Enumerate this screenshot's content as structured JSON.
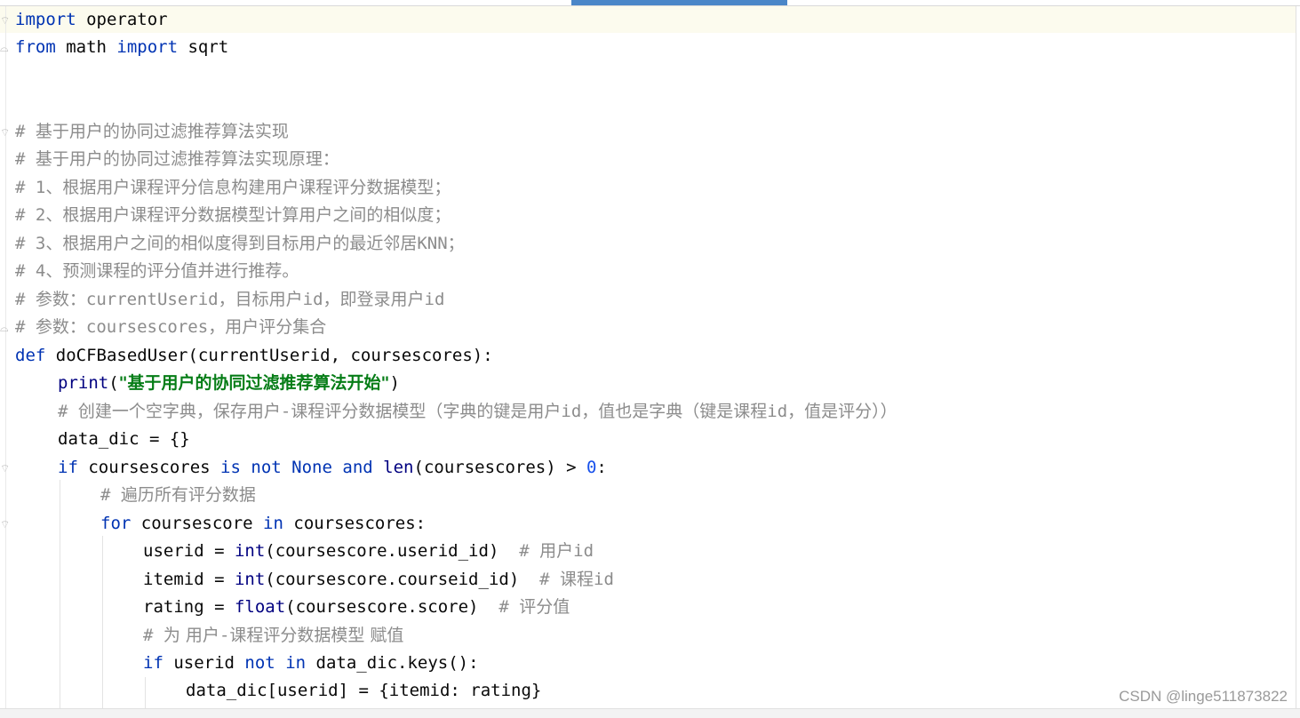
{
  "editor": {
    "colors": {
      "keyword": "#0033b3",
      "comment": "#8c8c8c",
      "string": "#067d17",
      "number": "#1750eb",
      "current_line": "#fcfbee"
    },
    "code": {
      "l1": {
        "kw_import": "import",
        "rest": " operator"
      },
      "l2": {
        "kw_from": "from",
        "mid": " math ",
        "kw_import": "import",
        "rest": " sqrt"
      },
      "l3": {
        "hash": "# ",
        "text": "基于用户的协同过滤推荐算法实现"
      },
      "l4": {
        "hash": "# ",
        "text": "基于用户的协同过滤推荐算法实现原理："
      },
      "l5": {
        "hash": "# 1",
        "text": "、根据用户课程评分信息构建用户课程评分数据模型；"
      },
      "l6": {
        "hash": "# 2",
        "text": "、根据用户课程评分数据模型计算用户之间的相似度；"
      },
      "l7": {
        "hash": "# 3",
        "text": "、根据用户之间的相似度得到目标用户的最近邻居",
        "tail": "KNN；"
      },
      "l8": {
        "hash": "# 4",
        "text": "、预测课程的评分值并进行推荐。"
      },
      "l9": {
        "hash": "# ",
        "text1": "参数：",
        "mono1": "currentUserid",
        "text2": "，目标用户",
        "mono2": "id",
        "text3": "，即登录用户",
        "mono3": "id"
      },
      "l10": {
        "hash": "# ",
        "text1": "参数：",
        "mono1": "coursescores",
        "text2": "，用户评分集合"
      },
      "l11": {
        "kw_def": "def",
        "rest": " doCFBasedUser(currentUserid, coursescores):"
      },
      "l12": {
        "fn": "print",
        "open": "(",
        "str": "\"基于用户的协同过滤推荐算法开始\"",
        "close": ")"
      },
      "l13": {
        "hash": "# ",
        "text1": "创建一个空字典，保存用户",
        "mono1": "-",
        "text2": "课程评分数据模型（字典的键是用户",
        "mono2": "id",
        "text3": "，值也是字典（键是课程",
        "mono3": "id",
        "text4": "，值是评分））"
      },
      "l14": {
        "code": "data_dic = {}"
      },
      "l15": {
        "kw_if": "if",
        "a": " coursescores ",
        "kw_is": "is",
        "sp1": " ",
        "kw_not": "not",
        "sp2": " ",
        "kw_none": "None",
        "sp3": " ",
        "kw_and": "and",
        "sp4": " ",
        "fn_len": "len",
        "b": "(coursescores) > ",
        "num": "0",
        "c": ":"
      },
      "l16": {
        "hash": "# ",
        "text": "遍历所有评分数据"
      },
      "l17": {
        "kw_for": "for",
        "a": " coursescore ",
        "kw_in": "in",
        "b": " coursescores:"
      },
      "l18": {
        "a": "userid = ",
        "fn": "int",
        "b": "(coursescore.userid_id)  ",
        "hash": "# ",
        "text": "用户",
        "mono": "id"
      },
      "l19": {
        "a": "itemid = ",
        "fn": "int",
        "b": "(coursescore.courseid_id)  ",
        "hash": "# ",
        "text": "课程",
        "mono": "id"
      },
      "l20": {
        "a": "rating = ",
        "fn": "float",
        "b": "(coursescore.score)  ",
        "hash": "# ",
        "text": "评分值"
      },
      "l21": {
        "hash": "# ",
        "text1": "为 用户",
        "mono1": "-",
        "text2": "课程评分数据模型 赋值"
      },
      "l22": {
        "kw_if": "if",
        "a": " userid ",
        "kw_not": "not",
        "sp": " ",
        "kw_in": "in",
        "b": " data_dic.keys():"
      },
      "l23": {
        "code": "data_dic[userid] = {itemid: rating}"
      }
    }
  },
  "watermark": "CSDN @linge511873822"
}
